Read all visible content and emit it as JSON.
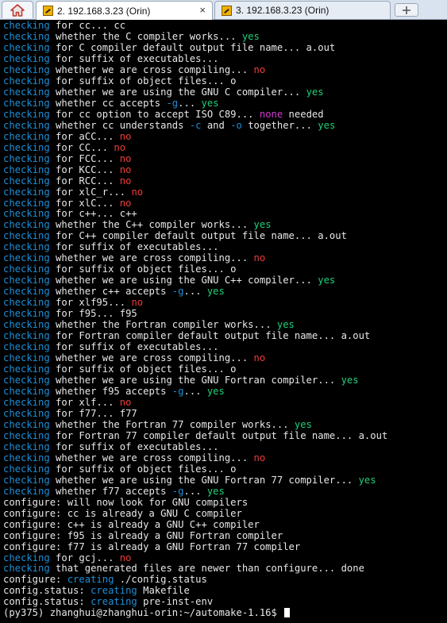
{
  "colors": {
    "blue": "#1e8fd6",
    "green": "#1fd07a",
    "red": "#ef3b3b",
    "magenta": "#d23ad2",
    "text": "#e8e8e8",
    "background": "#000000"
  },
  "tabs": [
    {
      "label": "2. 192.168.3.23 (Orin)",
      "active": true,
      "close": "×"
    },
    {
      "label": "3. 192.168.3.23 (Orin)",
      "active": false
    }
  ],
  "new_tab": "+",
  "terminal": {
    "lines": [
      [
        [
          "b",
          "checking"
        ],
        [
          "t",
          " for cc... cc"
        ]
      ],
      [
        [
          "b",
          "checking"
        ],
        [
          "t",
          " whether the C compiler works... "
        ],
        [
          "g",
          "yes"
        ]
      ],
      [
        [
          "b",
          "checking"
        ],
        [
          "t",
          " for C compiler default output file name... a.out"
        ]
      ],
      [
        [
          "b",
          "checking"
        ],
        [
          "t",
          " for suffix of executables..."
        ]
      ],
      [
        [
          "b",
          "checking"
        ],
        [
          "t",
          " whether we are cross compiling... "
        ],
        [
          "r",
          "no"
        ]
      ],
      [
        [
          "b",
          "checking"
        ],
        [
          "t",
          " for suffix of object files... o"
        ]
      ],
      [
        [
          "b",
          "checking"
        ],
        [
          "t",
          " whether we are using the GNU C compiler... "
        ],
        [
          "g",
          "yes"
        ]
      ],
      [
        [
          "b",
          "checking"
        ],
        [
          "t",
          " whether cc accepts "
        ],
        [
          "b",
          "-g"
        ],
        [
          "t",
          "... "
        ],
        [
          "g",
          "yes"
        ]
      ],
      [
        [
          "b",
          "checking"
        ],
        [
          "t",
          " for cc option to accept ISO C89... "
        ],
        [
          "m",
          "none"
        ],
        [
          "t",
          " needed"
        ]
      ],
      [
        [
          "b",
          "checking"
        ],
        [
          "t",
          " whether cc understands "
        ],
        [
          "b",
          "-c"
        ],
        [
          "t",
          " and "
        ],
        [
          "b",
          "-o"
        ],
        [
          "t",
          " together... "
        ],
        [
          "g",
          "yes"
        ]
      ],
      [
        [
          "b",
          "checking"
        ],
        [
          "t",
          " for aCC... "
        ],
        [
          "r",
          "no"
        ]
      ],
      [
        [
          "b",
          "checking"
        ],
        [
          "t",
          " for CC... "
        ],
        [
          "r",
          "no"
        ]
      ],
      [
        [
          "b",
          "checking"
        ],
        [
          "t",
          " for FCC... "
        ],
        [
          "r",
          "no"
        ]
      ],
      [
        [
          "b",
          "checking"
        ],
        [
          "t",
          " for KCC... "
        ],
        [
          "r",
          "no"
        ]
      ],
      [
        [
          "b",
          "checking"
        ],
        [
          "t",
          " for RCC... "
        ],
        [
          "r",
          "no"
        ]
      ],
      [
        [
          "b",
          "checking"
        ],
        [
          "t",
          " for xlC_r... "
        ],
        [
          "r",
          "no"
        ]
      ],
      [
        [
          "b",
          "checking"
        ],
        [
          "t",
          " for xlC... "
        ],
        [
          "r",
          "no"
        ]
      ],
      [
        [
          "b",
          "checking"
        ],
        [
          "t",
          " for c++... c++"
        ]
      ],
      [
        [
          "b",
          "checking"
        ],
        [
          "t",
          " whether the C++ compiler works... "
        ],
        [
          "g",
          "yes"
        ]
      ],
      [
        [
          "b",
          "checking"
        ],
        [
          "t",
          " for C++ compiler default output file name... a.out"
        ]
      ],
      [
        [
          "b",
          "checking"
        ],
        [
          "t",
          " for suffix of executables..."
        ]
      ],
      [
        [
          "b",
          "checking"
        ],
        [
          "t",
          " whether we are cross compiling... "
        ],
        [
          "r",
          "no"
        ]
      ],
      [
        [
          "b",
          "checking"
        ],
        [
          "t",
          " for suffix of object files... o"
        ]
      ],
      [
        [
          "b",
          "checking"
        ],
        [
          "t",
          " whether we are using the GNU C++ compiler... "
        ],
        [
          "g",
          "yes"
        ]
      ],
      [
        [
          "b",
          "checking"
        ],
        [
          "t",
          " whether c++ accepts "
        ],
        [
          "b",
          "-g"
        ],
        [
          "t",
          "... "
        ],
        [
          "g",
          "yes"
        ]
      ],
      [
        [
          "b",
          "checking"
        ],
        [
          "t",
          " for xlf95... "
        ],
        [
          "r",
          "no"
        ]
      ],
      [
        [
          "b",
          "checking"
        ],
        [
          "t",
          " for f95... f95"
        ]
      ],
      [
        [
          "b",
          "checking"
        ],
        [
          "t",
          " whether the Fortran compiler works... "
        ],
        [
          "g",
          "yes"
        ]
      ],
      [
        [
          "b",
          "checking"
        ],
        [
          "t",
          " for Fortran compiler default output file name... a.out"
        ]
      ],
      [
        [
          "b",
          "checking"
        ],
        [
          "t",
          " for suffix of executables..."
        ]
      ],
      [
        [
          "b",
          "checking"
        ],
        [
          "t",
          " whether we are cross compiling... "
        ],
        [
          "r",
          "no"
        ]
      ],
      [
        [
          "b",
          "checking"
        ],
        [
          "t",
          " for suffix of object files... o"
        ]
      ],
      [
        [
          "b",
          "checking"
        ],
        [
          "t",
          " whether we are using the GNU Fortran compiler... "
        ],
        [
          "g",
          "yes"
        ]
      ],
      [
        [
          "b",
          "checking"
        ],
        [
          "t",
          " whether f95 accepts "
        ],
        [
          "b",
          "-g"
        ],
        [
          "t",
          "... "
        ],
        [
          "g",
          "yes"
        ]
      ],
      [
        [
          "b",
          "checking"
        ],
        [
          "t",
          " for xlf... "
        ],
        [
          "r",
          "no"
        ]
      ],
      [
        [
          "b",
          "checking"
        ],
        [
          "t",
          " for f77... f77"
        ]
      ],
      [
        [
          "b",
          "checking"
        ],
        [
          "t",
          " whether the Fortran 77 compiler works... "
        ],
        [
          "g",
          "yes"
        ]
      ],
      [
        [
          "b",
          "checking"
        ],
        [
          "t",
          " for Fortran 77 compiler default output file name... a.out"
        ]
      ],
      [
        [
          "b",
          "checking"
        ],
        [
          "t",
          " for suffix of executables..."
        ]
      ],
      [
        [
          "b",
          "checking"
        ],
        [
          "t",
          " whether we are cross compiling... "
        ],
        [
          "r",
          "no"
        ]
      ],
      [
        [
          "b",
          "checking"
        ],
        [
          "t",
          " for suffix of object files... o"
        ]
      ],
      [
        [
          "b",
          "checking"
        ],
        [
          "t",
          " whether we are using the GNU Fortran 77 compiler... "
        ],
        [
          "g",
          "yes"
        ]
      ],
      [
        [
          "b",
          "checking"
        ],
        [
          "t",
          " whether f77 accepts "
        ],
        [
          "b",
          "-g"
        ],
        [
          "t",
          "... "
        ],
        [
          "g",
          "yes"
        ]
      ],
      [
        [
          "t",
          "configure: will now look for GNU compilers"
        ]
      ],
      [
        [
          "t",
          "configure: cc is already a GNU C compiler"
        ]
      ],
      [
        [
          "t",
          "configure: c++ is already a GNU C++ compiler"
        ]
      ],
      [
        [
          "t",
          "configure: f95 is already a GNU Fortran compiler"
        ]
      ],
      [
        [
          "t",
          "configure: f77 is already a GNU Fortran 77 compiler"
        ]
      ],
      [
        [
          "b",
          "checking"
        ],
        [
          "t",
          " for gcj... "
        ],
        [
          "r",
          "no"
        ]
      ],
      [
        [
          "b",
          "checking"
        ],
        [
          "t",
          " that generated files are newer than configure... done"
        ]
      ],
      [
        [
          "t",
          "configure: "
        ],
        [
          "b",
          "creating"
        ],
        [
          "t",
          " ./config.status"
        ]
      ],
      [
        [
          "t",
          "config.status: "
        ],
        [
          "b",
          "creating"
        ],
        [
          "t",
          " Makefile"
        ]
      ],
      [
        [
          "t",
          "config.status: "
        ],
        [
          "b",
          "creating"
        ],
        [
          "t",
          " pre-inst-env"
        ]
      ],
      [
        [
          "t",
          "(py375) zhanghui@zhanghui-orin:~/automake-1.16$ "
        ]
      ]
    ]
  }
}
